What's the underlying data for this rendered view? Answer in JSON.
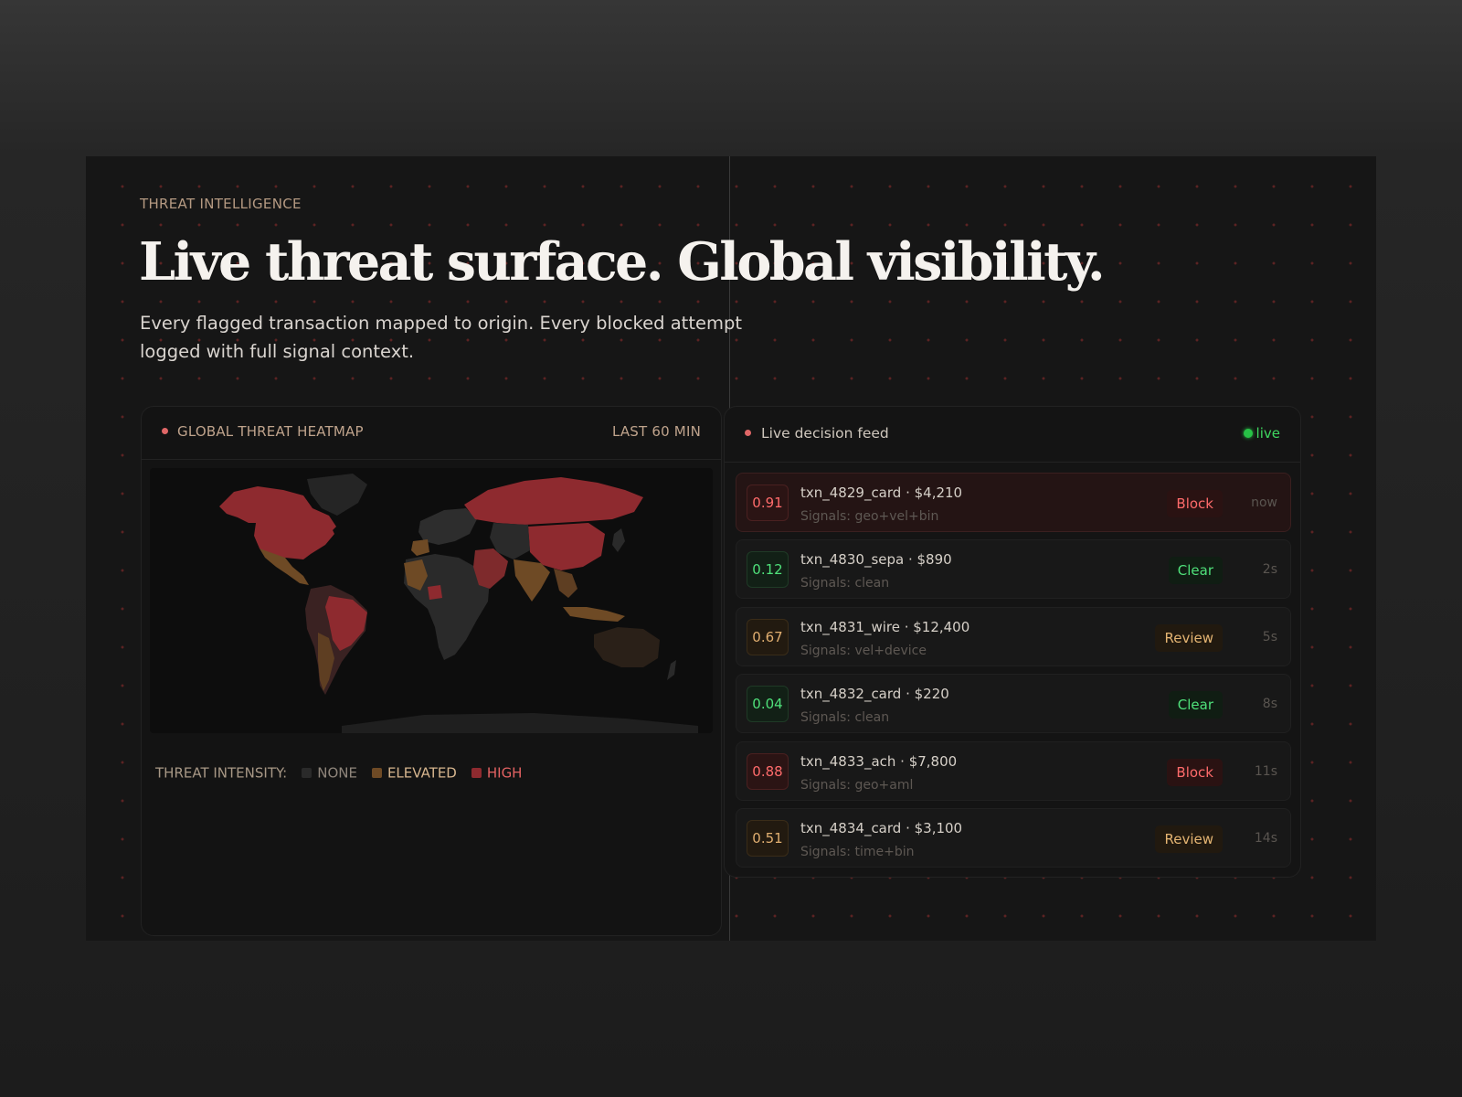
{
  "section": {
    "eyebrow": "THREAT INTELLIGENCE",
    "headline": "Live threat surface. Global visibility.",
    "subtitle": "Every flagged transaction mapped to origin. Every blocked attempt logged with full signal context."
  },
  "heatmap": {
    "title": "GLOBAL THREAT HEATMAP",
    "range": "LAST 60 MIN",
    "legend": {
      "label": "THREAT INTENSITY:",
      "none": "NONE",
      "elevated": "ELEVATED",
      "high": "HIGH"
    },
    "colors": {
      "none": "#2a2a2a",
      "elevated": "#6e4a25",
      "high": "#8e2a2f"
    }
  },
  "feed": {
    "title": "Live decision feed",
    "status": "live",
    "rows": [
      {
        "score": "0.91",
        "txn": "txn_4829_card · $4,210",
        "signals": "Signals: geo+vel+bin",
        "action": "Block",
        "time": "now"
      },
      {
        "score": "0.12",
        "txn": "txn_4830_sepa · $890",
        "signals": "Signals: clean",
        "action": "Clear",
        "time": "2s"
      },
      {
        "score": "0.67",
        "txn": "txn_4831_wire · $12,400",
        "signals": "Signals: vel+device",
        "action": "Review",
        "time": "5s"
      },
      {
        "score": "0.04",
        "txn": "txn_4832_card · $220",
        "signals": "Signals: clean",
        "action": "Clear",
        "time": "8s"
      },
      {
        "score": "0.88",
        "txn": "txn_4833_ach · $7,800",
        "signals": "Signals: geo+aml",
        "action": "Block",
        "time": "11s"
      },
      {
        "score": "0.51",
        "txn": "txn_4834_card · $3,100",
        "signals": "Signals: time+bin",
        "action": "Review",
        "time": "14s"
      }
    ]
  }
}
